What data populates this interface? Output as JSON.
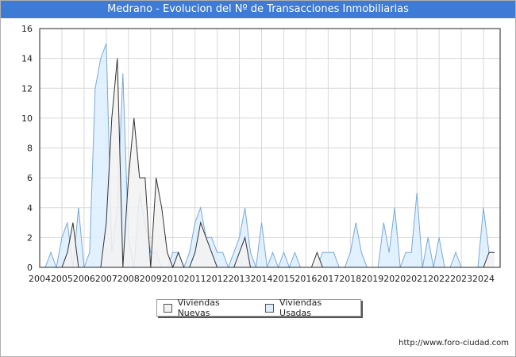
{
  "title": "Medrano - Evolucion del Nº de Transacciones Inmobiliarias",
  "credit": "http://www.foro-ciudad.com",
  "colors": {
    "title_bg": "#3e7bd6",
    "nuevas_fill": "#f2f2f2",
    "nuevas_line": "#333333",
    "usadas_fill": "#ddeeff",
    "usadas_line": "#7aa8d8"
  },
  "chart_data": {
    "type": "area",
    "title": "Medrano - Evolucion del Nº de Transacciones Inmobiliarias",
    "xlabel": "",
    "ylabel": "",
    "xlim": [
      2004,
      2024.75
    ],
    "ylim": [
      0,
      16
    ],
    "yticks": [
      0,
      2,
      4,
      6,
      8,
      10,
      12,
      14,
      16
    ],
    "xticks": [
      "2004",
      "2005",
      "2006",
      "2007",
      "2008",
      "2009",
      "2010",
      "2011",
      "2012",
      "2013",
      "2014",
      "2015",
      "2016",
      "2017",
      "2018",
      "2019",
      "2020",
      "2021",
      "2022",
      "2023",
      "2024"
    ],
    "grid": true,
    "legend_position": "bottom-center",
    "series": [
      {
        "name": "Viviendas Nuevas",
        "x": [
          2004.0,
          2004.25,
          2004.5,
          2004.75,
          2005.0,
          2005.25,
          2005.5,
          2005.75,
          2006.0,
          2006.25,
          2006.5,
          2006.75,
          2007.0,
          2007.25,
          2007.5,
          2007.75,
          2008.0,
          2008.25,
          2008.5,
          2008.75,
          2009.0,
          2009.25,
          2009.5,
          2009.75,
          2010.0,
          2010.25,
          2010.5,
          2010.75,
          2011.0,
          2011.25,
          2011.5,
          2011.75,
          2012.0,
          2012.25,
          2012.5,
          2012.75,
          2013.0,
          2013.25,
          2013.5,
          2013.75,
          2014.0,
          2014.25,
          2014.5,
          2014.75,
          2015.0,
          2015.25,
          2015.5,
          2015.75,
          2016.0,
          2016.25,
          2016.5,
          2016.75,
          2017.0,
          2017.25,
          2017.5,
          2017.75,
          2018.0,
          2018.25,
          2018.5,
          2018.75,
          2019.0,
          2019.25,
          2019.5,
          2019.75,
          2020.0,
          2020.25,
          2020.5,
          2020.75,
          2021.0,
          2021.25,
          2021.5,
          2021.75,
          2022.0,
          2022.25,
          2022.5,
          2022.75,
          2023.0,
          2023.25,
          2023.5,
          2023.75,
          2024.0,
          2024.25,
          2024.5
        ],
        "values": [
          0,
          0,
          0,
          0,
          0,
          1,
          3,
          0,
          0,
          0,
          0,
          0,
          3,
          10,
          14,
          0,
          6,
          10,
          6,
          6,
          0,
          6,
          4,
          1,
          0,
          1,
          0,
          0,
          1,
          3,
          2,
          1,
          0,
          0,
          0,
          0,
          1,
          2,
          0,
          0,
          0,
          0,
          0,
          0,
          0,
          0,
          0,
          0,
          0,
          0,
          1,
          0,
          0,
          0,
          0,
          0,
          0,
          0,
          0,
          0,
          0,
          0,
          0,
          0,
          0,
          0,
          0,
          0,
          0,
          0,
          0,
          0,
          0,
          0,
          0,
          0,
          0,
          0,
          0,
          0,
          0,
          1,
          1
        ]
      },
      {
        "name": "Viviendas Usadas",
        "x": [
          2004.0,
          2004.25,
          2004.5,
          2004.75,
          2005.0,
          2005.25,
          2005.5,
          2005.75,
          2006.0,
          2006.25,
          2006.5,
          2006.75,
          2007.0,
          2007.25,
          2007.5,
          2007.75,
          2008.0,
          2008.25,
          2008.5,
          2008.75,
          2009.0,
          2009.25,
          2009.5,
          2009.75,
          2010.0,
          2010.25,
          2010.5,
          2010.75,
          2011.0,
          2011.25,
          2011.5,
          2011.75,
          2012.0,
          2012.25,
          2012.5,
          2012.75,
          2013.0,
          2013.25,
          2013.5,
          2013.75,
          2014.0,
          2014.25,
          2014.5,
          2014.75,
          2015.0,
          2015.25,
          2015.5,
          2015.75,
          2016.0,
          2016.25,
          2016.5,
          2016.75,
          2017.0,
          2017.25,
          2017.5,
          2017.75,
          2018.0,
          2018.25,
          2018.5,
          2018.75,
          2019.0,
          2019.25,
          2019.5,
          2019.75,
          2020.0,
          2020.25,
          2020.5,
          2020.75,
          2021.0,
          2021.25,
          2021.5,
          2021.75,
          2022.0,
          2022.25,
          2022.5,
          2022.75,
          2023.0,
          2023.25,
          2023.5,
          2023.75,
          2024.0,
          2024.25,
          2024.5
        ],
        "values": [
          0,
          0,
          1,
          0,
          2,
          3,
          0,
          4,
          0,
          1,
          12,
          14,
          15,
          1,
          4,
          13,
          2,
          0,
          5,
          3,
          1,
          1,
          0,
          0,
          1,
          1,
          0,
          1,
          3,
          4,
          2,
          2,
          1,
          1,
          0,
          1,
          2,
          4,
          1,
          0,
          3,
          0,
          1,
          0,
          1,
          0,
          1,
          0,
          0,
          0,
          0,
          1,
          1,
          1,
          0,
          0,
          1,
          3,
          1,
          0,
          0,
          0,
          3,
          1,
          4,
          0,
          1,
          1,
          5,
          0,
          2,
          0,
          2,
          0,
          0,
          1,
          0,
          0,
          0,
          0,
          4,
          1,
          1
        ]
      }
    ]
  },
  "legend": {
    "nuevas_label": "Viviendas Nuevas",
    "usadas_label": "Viviendas Usadas"
  }
}
